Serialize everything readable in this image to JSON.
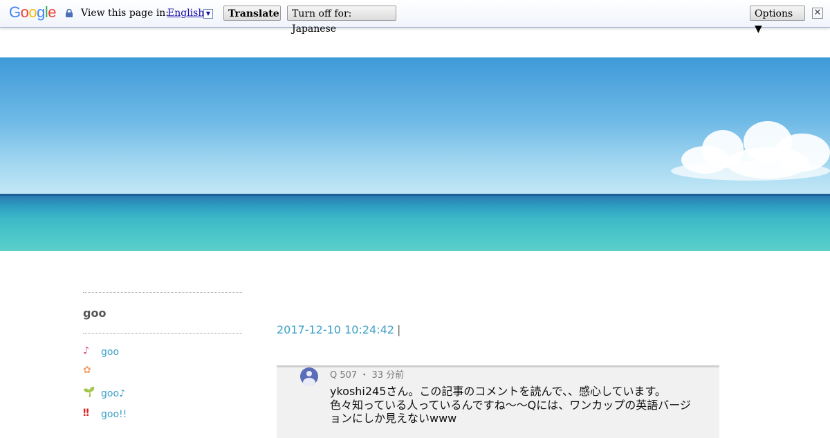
{
  "translate_bar": {
    "logo": "Google",
    "view_text": "View this page in:",
    "language": "English",
    "translate_label": "Translate",
    "turn_off_label": "Turn off for: Japanese",
    "options_label": "Options ▼",
    "close_label": "✕"
  },
  "sidebar": {
    "title": "goo",
    "items": [
      {
        "icon": "music-note-icon",
        "glyph": "♪",
        "label": "goo"
      },
      {
        "icon": "flower-icon",
        "glyph": "✿",
        "label": ""
      },
      {
        "icon": "sprout-icon",
        "glyph": "🌱",
        "label": "goo♪"
      },
      {
        "icon": "double-exclamation-icon",
        "glyph": "‼",
        "label": "goo!!"
      }
    ]
  },
  "post": {
    "datetime": "2017-12-10 10:24:42",
    "separator": "|",
    "comment": {
      "author_meta": "Q 507 ・ 33 分前",
      "lines": [
        "ykoshi245さん。この記事のコメントを読んで、、感心しています。",
        "色々知っている人っているんですね〜〜Qには、ワンカップの英語バージ",
        "ョンにしか見えないwww"
      ]
    }
  },
  "colors": {
    "link": "#3aa0c8",
    "sidebar_title": "#555555"
  }
}
